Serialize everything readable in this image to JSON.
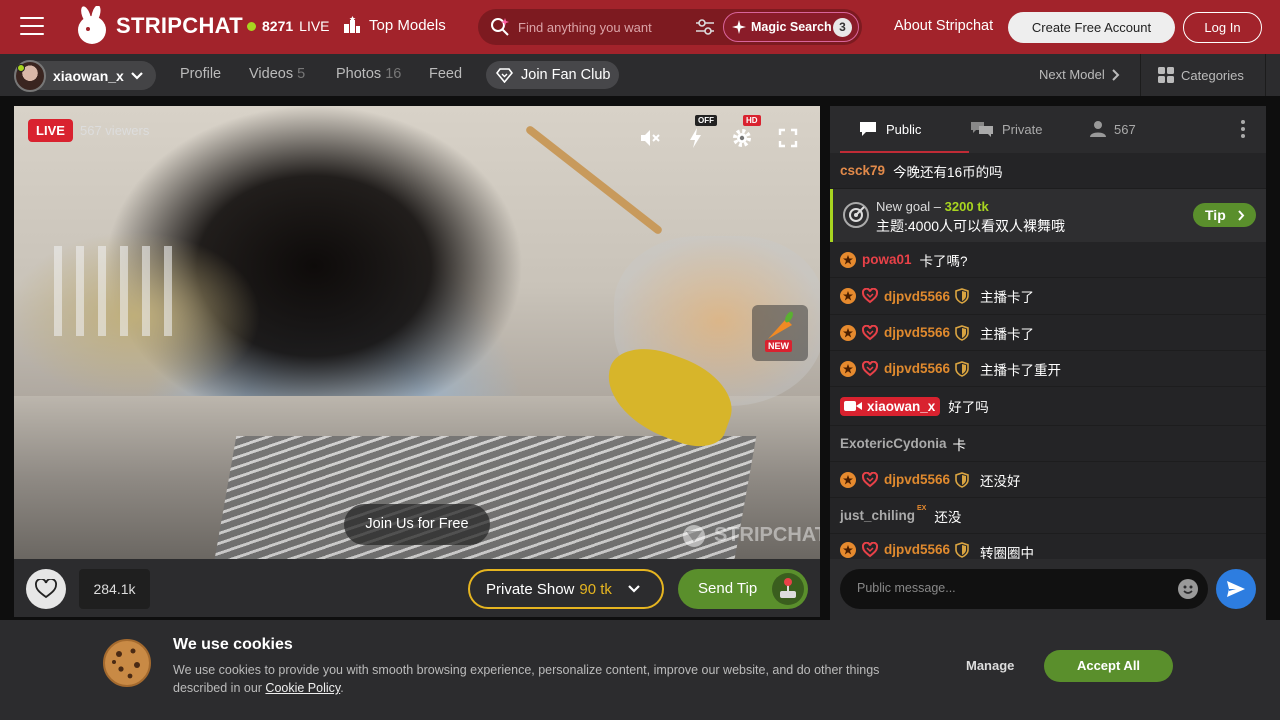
{
  "header": {
    "logo_text": "STRIPCHAT",
    "live_count": "8271",
    "live_label": "LIVE",
    "top_models": "Top Models",
    "search_placeholder": "Find anything you want",
    "magic_search": "Magic Search",
    "magic_count": "3",
    "about": "About Stripchat",
    "create_account": "Create Free Account",
    "login": "Log In"
  },
  "subnav": {
    "model_name": "xiaowan_x",
    "tabs": [
      {
        "label": "Profile",
        "count": ""
      },
      {
        "label": "Videos",
        "count": "5"
      },
      {
        "label": "Photos",
        "count": "16"
      },
      {
        "label": "Feed",
        "count": ""
      }
    ],
    "fan_club": "Join Fan Club",
    "next_model": "Next Model",
    "categories": "Categories"
  },
  "video": {
    "live_badge": "LIVE",
    "viewers": "567 viewers",
    "tag_off": "OFF",
    "tag_hd": "HD",
    "new_tag": "NEW",
    "join_free": "Join Us for Free",
    "watermark": "STRIPCHAT"
  },
  "video_bar": {
    "like_count": "284.1k",
    "private_show": "Private Show",
    "private_price": "90 tk",
    "send_tip": "Send Tip"
  },
  "chat": {
    "tabs": {
      "public": "Public",
      "private": "Private",
      "users": "567"
    },
    "first_msg": {
      "user": "csck79",
      "text": "今晚还有16币的吗"
    },
    "goal": {
      "label": "New goal –",
      "amount": "3200 tk",
      "text": "主题:4000人可以看双人裸舞哦",
      "tip": "Tip"
    },
    "messages": [
      {
        "user": "powa01",
        "text": "卡了嗎?"
      },
      {
        "user": "djpvd5566",
        "text": "主播卡了"
      },
      {
        "user": "djpvd5566",
        "text": "主播卡了"
      },
      {
        "user": "djpvd5566",
        "text": "主播卡了重开"
      },
      {
        "user": "xiaowan_x",
        "text": "好了吗"
      },
      {
        "user": "ExotericCydonia",
        "text": "卡"
      },
      {
        "user": "djpvd5566",
        "text": "还没好"
      },
      {
        "user": "just_chiling",
        "badge": "EX",
        "text": "还没"
      },
      {
        "user": "djpvd5566",
        "text": "转圈圈中"
      }
    ],
    "input_placeholder": "Public message..."
  },
  "cookie": {
    "title": "We use cookies",
    "text": "We use cookies to provide you with smooth browsing experience, personalize content, improve our website, and do other things described in our ",
    "link": "Cookie Policy",
    "period": ".",
    "manage": "Manage",
    "accept": "Accept All"
  },
  "colors": {
    "header": "#a2232b",
    "live_green": "#a8d520",
    "accent_red": "#d9222f",
    "tip_green": "#5a8f2c",
    "private_gold": "#e6b520",
    "send_blue": "#2d7de0"
  }
}
